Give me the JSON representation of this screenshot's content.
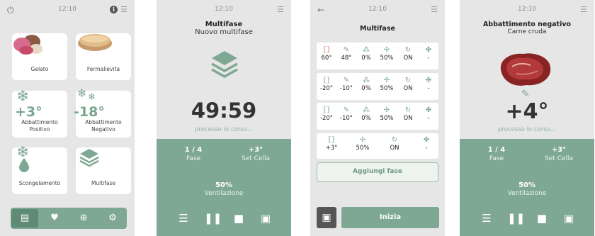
{
  "screen1": {
    "time": "12:10",
    "tiles": [
      {
        "label": "Gelato"
      },
      {
        "label": "Fermalievita"
      },
      {
        "label": "Abbattimento\nPositivo",
        "temp": "+3°"
      },
      {
        "label": "Abbattimento\nNegativo",
        "temp": "-18°"
      },
      {
        "label": "Scongelamento"
      },
      {
        "label": "Multifase"
      }
    ]
  },
  "screen2": {
    "time": "12:10",
    "title": "Multifase",
    "subtitle": "Nuovo multifase",
    "timer": "49:59",
    "status": "processo in corso...",
    "phase_value": "1 / 4",
    "phase_label": "Fase",
    "cell_value": "+3°",
    "cell_label": "Set Cella",
    "vent_value": "50%",
    "vent_label": "Ventilazione"
  },
  "screen3": {
    "time": "12:10",
    "title": "Multifase",
    "rows": [
      [
        "60°",
        "48°",
        "0%",
        "50%",
        "ON",
        "-"
      ],
      [
        "-20°",
        "-10°",
        "0%",
        "50%",
        "ON",
        "-"
      ],
      [
        "-20°",
        "-10°",
        "0%",
        "50%",
        "ON",
        "-"
      ],
      [
        "+3°",
        "50%",
        "ON",
        "-"
      ]
    ],
    "add_label": "Aggiungi fase",
    "start_label": "Inizia"
  },
  "screen4": {
    "time": "12:10",
    "title": "Abbattimento negativo",
    "subtitle": "Carne cruda",
    "temp": "+4°",
    "status": "processo in corso...",
    "phase_value": "1 / 4",
    "phase_label": "Fase",
    "cell_value": "+3°",
    "cell_label": "Set Cella",
    "vent_value": "50%",
    "vent_label": "Ventilazione"
  }
}
